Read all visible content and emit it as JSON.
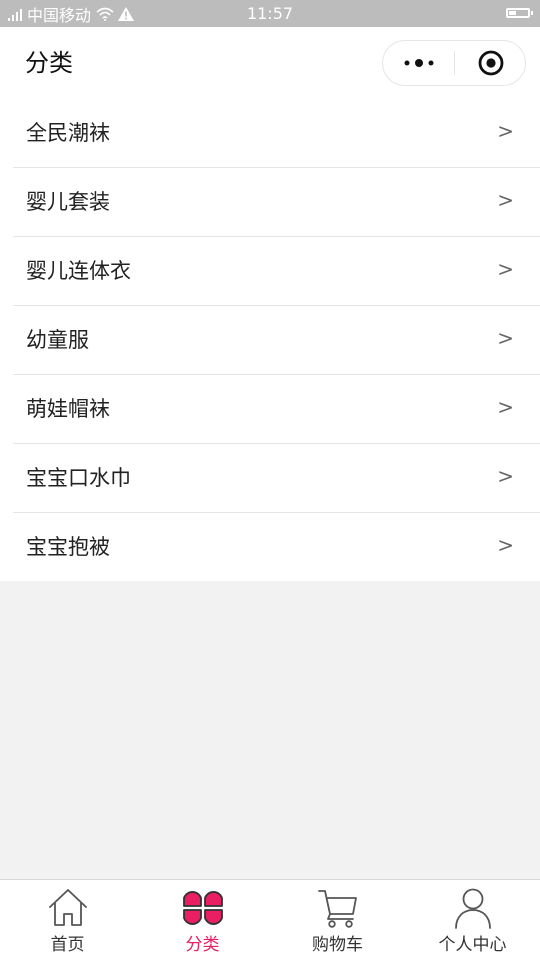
{
  "status_bar": {
    "carrier": "中国移动",
    "time": "11:57"
  },
  "header": {
    "title": "分类"
  },
  "categories": [
    {
      "label": "全民潮袜",
      "chevron": ">"
    },
    {
      "label": "婴儿套装",
      "chevron": ">"
    },
    {
      "label": "婴儿连体衣",
      "chevron": ">"
    },
    {
      "label": "幼童服",
      "chevron": ">"
    },
    {
      "label": "萌娃帽袜",
      "chevron": ">"
    },
    {
      "label": "宝宝口水巾",
      "chevron": ">"
    },
    {
      "label": "宝宝抱被",
      "chevron": ">"
    }
  ],
  "tab_bar": {
    "active_color": "#e91e63",
    "tabs": [
      {
        "label": "首页",
        "icon": "home-icon",
        "active": false
      },
      {
        "label": "分类",
        "icon": "category-icon",
        "active": true
      },
      {
        "label": "购物车",
        "icon": "cart-icon",
        "active": false
      },
      {
        "label": "个人中心",
        "icon": "user-icon",
        "active": false
      }
    ]
  }
}
